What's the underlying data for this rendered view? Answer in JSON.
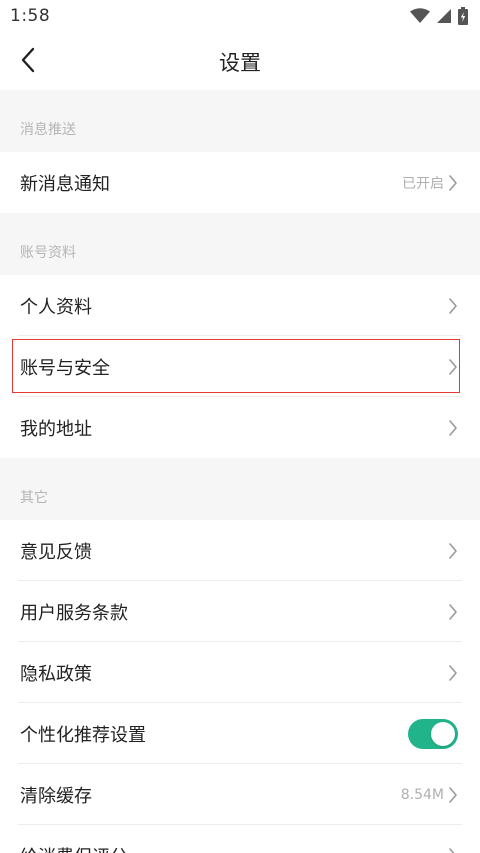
{
  "status_bar": {
    "time": "1:58",
    "icons": [
      "wifi-icon",
      "signal-icon",
      "battery-charging-icon"
    ]
  },
  "header": {
    "back_icon": "chevron-left-icon",
    "title": "设置"
  },
  "sections": {
    "push": {
      "label": "消息推送",
      "items": [
        {
          "label": "新消息通知",
          "value": "已开启"
        }
      ]
    },
    "account": {
      "label": "账号资料",
      "items": [
        {
          "label": "个人资料"
        },
        {
          "label": "账号与安全",
          "highlighted": true
        },
        {
          "label": "我的地址"
        }
      ]
    },
    "other": {
      "label": "其它",
      "items": [
        {
          "label": "意见反馈"
        },
        {
          "label": "用户服务条款"
        },
        {
          "label": "隐私政策"
        },
        {
          "label": "个性化推荐设置",
          "toggle_on": true
        },
        {
          "label": "清除缓存",
          "value": "8.54M"
        },
        {
          "label": "给消费保评分"
        }
      ]
    }
  },
  "colors": {
    "accent_toggle": "#21b38a",
    "highlight_border": "#e53935",
    "section_background": "#f6f6f6"
  }
}
